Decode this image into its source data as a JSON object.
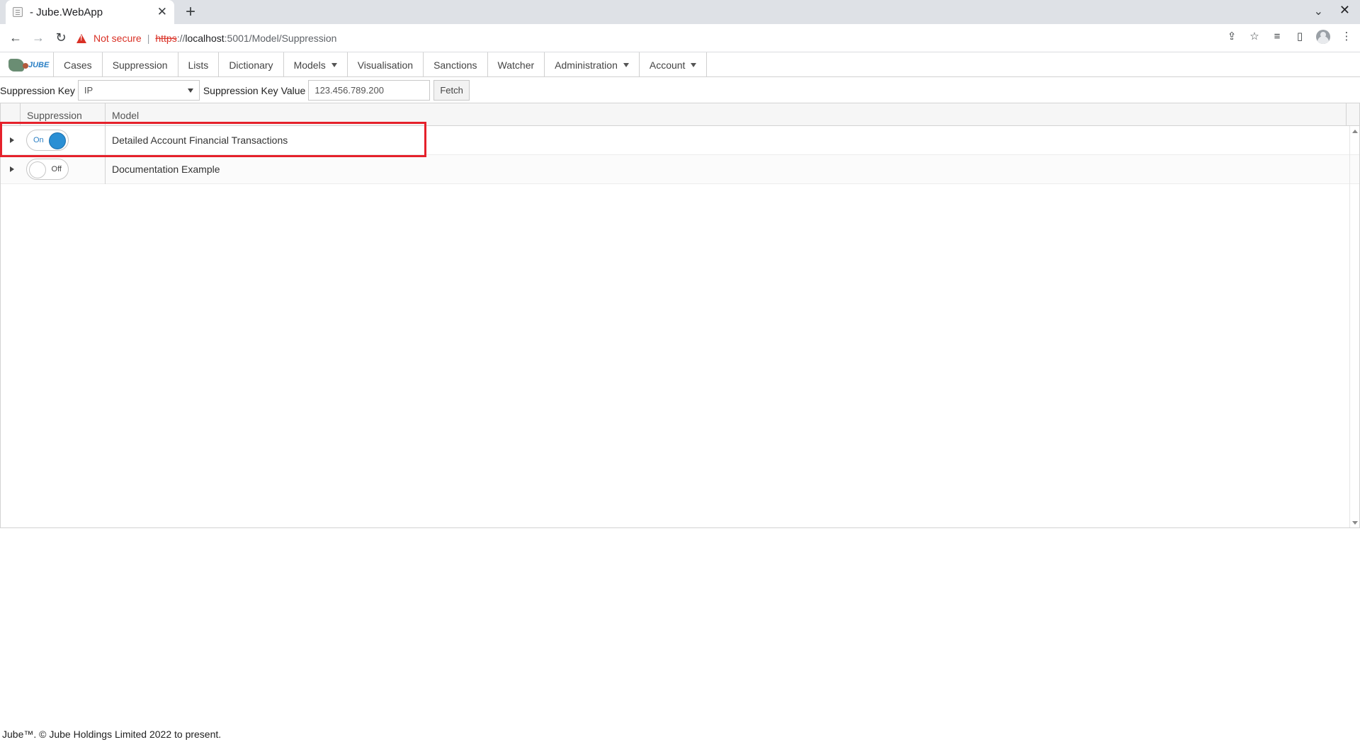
{
  "browser": {
    "tab_title": "- Jube.WebApp",
    "tab_close": "✕",
    "new_tab": "+",
    "security_label": "Not secure",
    "url_scheme": "https",
    "url_scheme_rest": "://",
    "url_host": "localhost",
    "url_path": ":5001/Model/Suppression"
  },
  "logo_text": "JUBE",
  "menu": {
    "items": [
      {
        "label": "Cases"
      },
      {
        "label": "Suppression"
      },
      {
        "label": "Lists"
      },
      {
        "label": "Dictionary"
      },
      {
        "label": "Models"
      },
      {
        "label": "Visualisation"
      },
      {
        "label": "Sanctions"
      },
      {
        "label": "Watcher"
      },
      {
        "label": "Administration"
      },
      {
        "label": "Account"
      }
    ]
  },
  "filter": {
    "key_label": "Suppression Key",
    "key_value": "IP",
    "value_label": "Suppression Key Value",
    "value": "123.456.789.200",
    "fetch_label": "Fetch"
  },
  "grid": {
    "columns": {
      "suppression": "Suppression",
      "model": "Model"
    },
    "rows": [
      {
        "toggle": "On",
        "model": "Detailed Account Financial Transactions"
      },
      {
        "toggle": "Off",
        "model": "Documentation Example"
      }
    ]
  },
  "footer": "Jube™. © Jube Holdings Limited 2022 to present."
}
